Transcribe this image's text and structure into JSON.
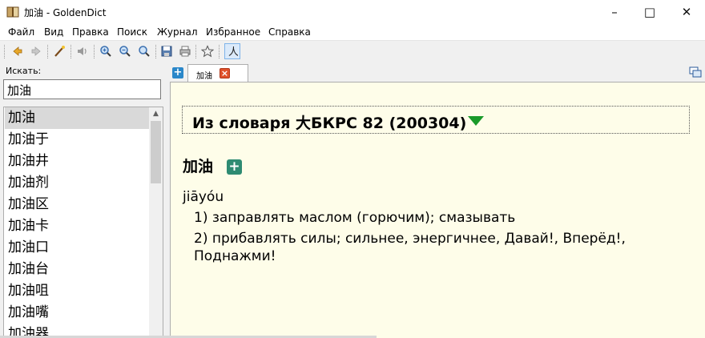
{
  "window": {
    "title": "加油 - GoldenDict",
    "controls": {
      "minimize": "–",
      "maximize": "□",
      "close": "✕"
    }
  },
  "menu": [
    "Файл",
    "Вид",
    "Правка",
    "Поиск",
    "Журнал",
    "Избранное",
    "Справка"
  ],
  "toolbar": {
    "buttons": [
      "back-icon",
      "forward-icon",
      "scan-popup-icon",
      "pronounce-icon",
      "zoom-in-icon",
      "zoom-out-icon",
      "zoom-reset-icon",
      "save-icon",
      "print-icon",
      "favorites-icon",
      "pinyin-icon"
    ]
  },
  "search": {
    "label": "Искать:",
    "value": "加油"
  },
  "wordlist": {
    "selected_index": 0,
    "items": [
      "加油",
      "加油于",
      "加油井",
      "加油剂",
      "加油区",
      "加油卡",
      "加油口",
      "加油台",
      "加油咀",
      "加油嘴",
      "加油器"
    ]
  },
  "tabs": [
    {
      "label": "加油",
      "active": true
    }
  ],
  "article": {
    "dict_title": "Из словаря 大БКРС 82 (200304)",
    "headword": "加油",
    "pinyin": "jiāyóu",
    "definitions": [
      "1) заправлять маслом (горючим); смазывать",
      "2) прибавлять силы; сильнее, энергичнее, Давай!, Вперёд!,",
      "Поднажми!"
    ]
  },
  "colors": {
    "article_bg": "#fefde9",
    "selection_bg": "#d9d9d9",
    "expand_arrow": "#1a9a2a",
    "add_button": "#2e8b72"
  }
}
